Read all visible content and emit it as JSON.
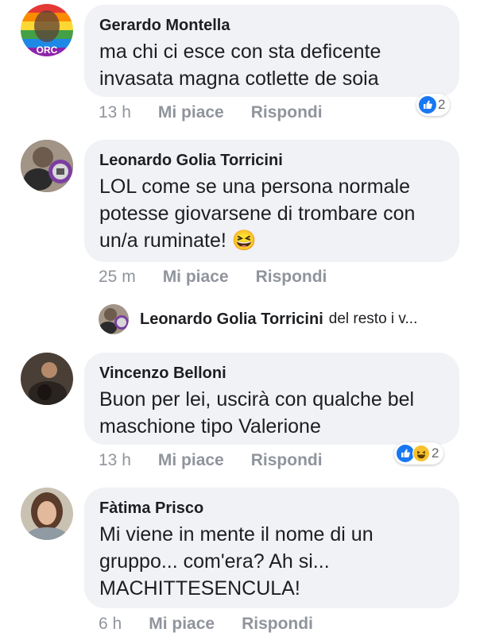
{
  "comments": [
    {
      "author": "Gerardo Montella",
      "lines": [
        "ma chi ci esce con sta deficente",
        "invasata magna cotlette de soia"
      ],
      "time": "13 h",
      "like": "Mi piace",
      "reply": "Rispondi",
      "reaction_count": "2",
      "reaction_types": [
        "like-icon"
      ]
    },
    {
      "author": "Leonardo Golia Torricini",
      "lines": [
        "LOL come se una persona normale",
        "potesse giovarsene di trombare con",
        "un/a ruminate! 😆"
      ],
      "time": "25 m",
      "like": "Mi piace",
      "reply": "Rispondi"
    },
    {
      "author": "Vincenzo Belloni",
      "lines": [
        "Buon per lei, uscirà con qualche bel",
        "maschione tipo Valerione"
      ],
      "time": "13 h",
      "like": "Mi piace",
      "reply": "Rispondi",
      "reaction_count": "2",
      "reaction_types": [
        "like-icon",
        "haha-icon"
      ]
    },
    {
      "author": "Fàtima Prisco",
      "lines": [
        "Mi viene in mente il nome di un",
        "gruppo... com'era? Ah si...",
        "MACHITTESENCULA!"
      ],
      "time": "6 h",
      "like": "Mi piace",
      "reply": "Rispondi"
    }
  ],
  "reply_preview": {
    "author": "Leonardo Golia Torricini",
    "snippet": "del resto i v..."
  },
  "avatar_text": "ORC",
  "colors": {
    "bubble": "#f0f2f5",
    "meta_text": "#90949c",
    "like_blue": "#1877f2",
    "haha_yellow": "#f7c22e"
  }
}
